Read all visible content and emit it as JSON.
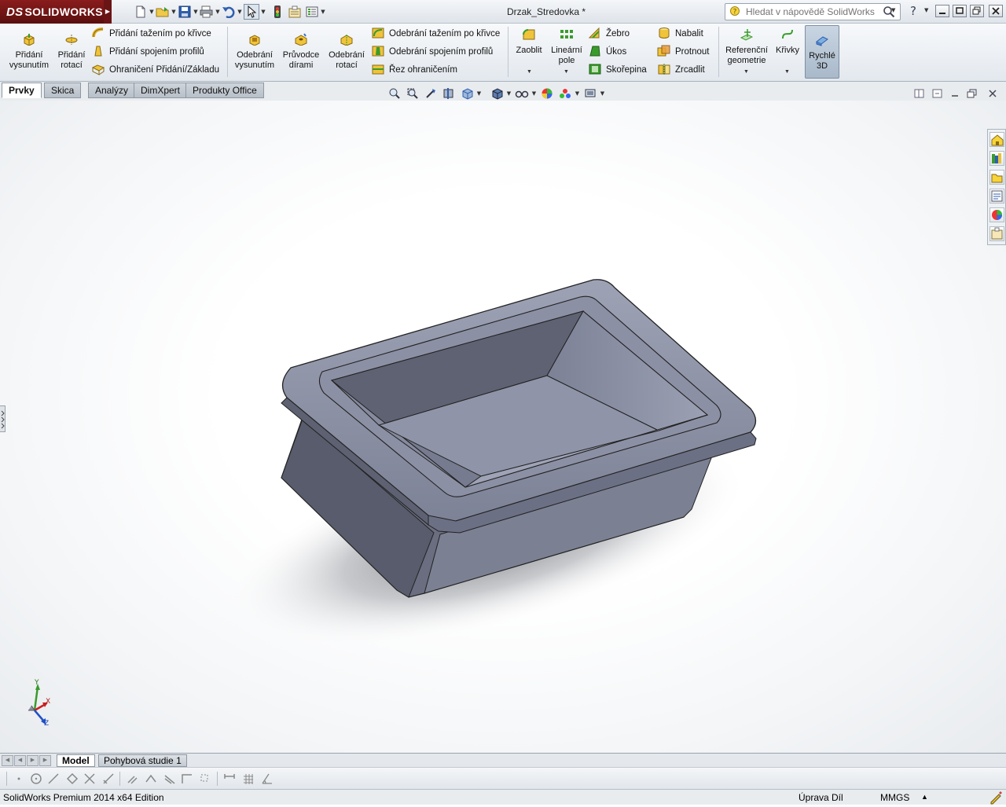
{
  "app": {
    "brand": "SOLIDWORKS",
    "brand_mark": "DS",
    "document_title": "Drzak_Stredovka *"
  },
  "search": {
    "placeholder": "Hledat v nápovědě SolidWorks"
  },
  "ribbon": {
    "pridani_vysunutim": "Přidání vysunutím",
    "pridani_rotaci": "Přidání rotací",
    "pridani_tazenim": "Přidání tažením po křivce",
    "pridani_spojenim": "Přidání spojením profilů",
    "ohraniceni_pridani": "Ohraničení Přidání/Základu",
    "odebrani_vysunutim": "Odebrání vysunutím",
    "pruvodce_dirami": "Průvodce dírami",
    "odebrani_rotaci": "Odebrání rotací",
    "odebrani_tazenim": "Odebrání tažením po křivce",
    "odebrani_spojenim": "Odebrání spojením profilů",
    "rez_ohranicenim": "Řez ohraničením",
    "zaoblit": "Zaoblit",
    "linearni_pole": "Lineární pole",
    "zebro": "Žebro",
    "ukos": "Úkos",
    "skorepina": "Skořepina",
    "nabalit": "Nabalit",
    "protnout": "Protnout",
    "zrcadlit": "Zrcadlit",
    "referencni_geometrie": "Referenční geometrie",
    "krivky": "Křivky",
    "rychle_3d": "Rychlé 3D"
  },
  "tabs": [
    "Prvky",
    "Skica",
    "Analýzy",
    "DimXpert",
    "Produkty Office"
  ],
  "bottom_tabs": [
    "Model",
    "Pohybová studie 1"
  ],
  "status": {
    "left": "SolidWorks Premium 2014 x64 Edition",
    "mode": "Úprava Díl",
    "units": "MMGS"
  },
  "triad": {
    "x": "X",
    "y": "Y",
    "z": "Z"
  },
  "colors": {
    "brand": "#7a1818",
    "model": "#8a8fa3",
    "ribbon_bg": "#eef1f5",
    "accent_yellow": "#e8c23a",
    "accent_green": "#3a9b2c"
  }
}
